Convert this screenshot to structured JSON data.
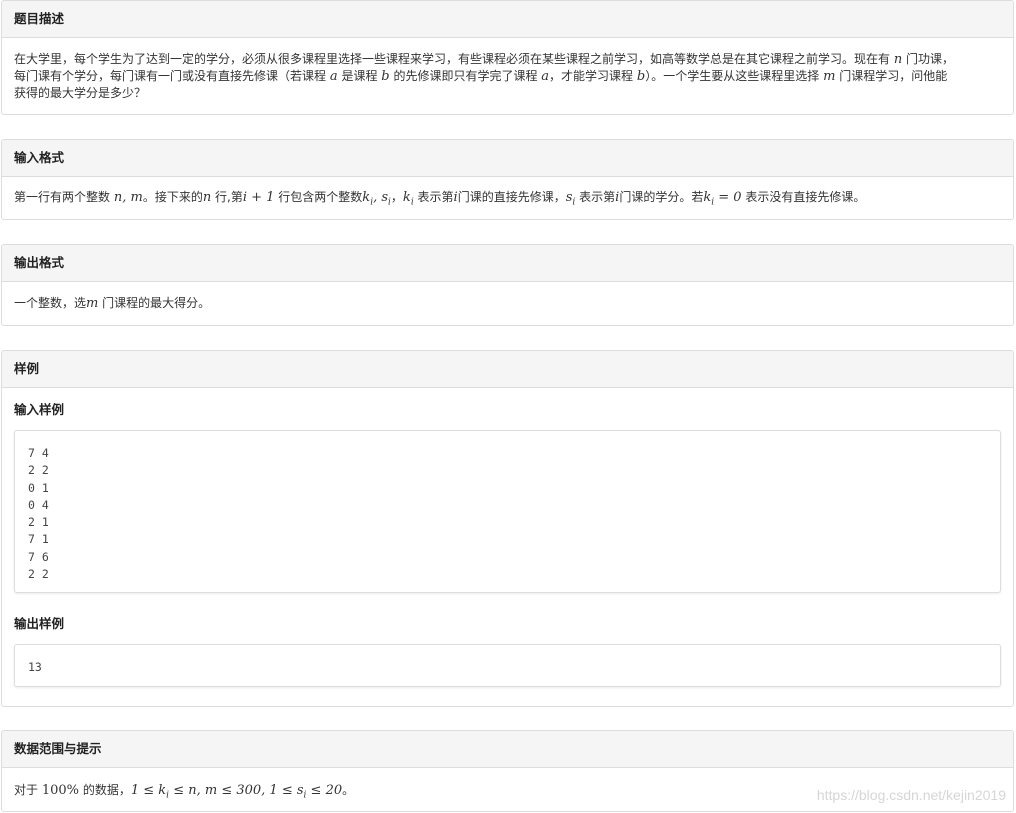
{
  "sections": {
    "description": {
      "title": "题目描述",
      "line1_a": "在大学里，每个学生为了达到一定的学分，必须从很多课程里选择一些课程来学习，有些课程必须在某些课程之前学习，如高等数学总是在其它课程之前学习。现在有",
      "line1_n": "n",
      "line1_b": "门功课，",
      "line2_a": "每门课有个学分，每门课有一门或没有直接先修课（若课程",
      "line2_a_var": "a",
      "line2_b": "是课程",
      "line2_b_var": "b",
      "line2_c": "的先修课即只有学完了课程",
      "line2_c_var": "a",
      "line2_d": "，才能学习课程",
      "line2_d_var": "b",
      "line2_e": "）。一个学生要从这些课程里选择",
      "line2_m": "m",
      "line2_f": "门课程学习，问他能",
      "line3": "获得的最大学分是多少？"
    },
    "input_format": {
      "title": "输入格式",
      "t1": "第一行有两个整数",
      "m1": "n, m",
      "t2": "。接下来的",
      "m2": "n",
      "t3": "行,第",
      "m3": "i + 1",
      "t4": "行包含两个整数",
      "m4": "k",
      "m4sub": "i",
      "m4b": ", s",
      "m4bsub": "i",
      "t5": "，",
      "m5": "k",
      "m5sub": "i",
      "t6": "表示第",
      "m6": "i",
      "t7": "门课的直接先修课，",
      "m7": "s",
      "m7sub": "i",
      "t8": "表示第",
      "m8": "i",
      "t9": "门课的学分。若",
      "m9": "k",
      "m9sub": "i",
      "m9b": " = 0",
      "t10": "表示没有直接先修课。"
    },
    "output_format": {
      "title": "输出格式",
      "t1": "一个整数，选",
      "m1": "m",
      "t2": "门课程的最大得分。"
    },
    "sample": {
      "title": "样例",
      "input_label": "输入样例",
      "input_text": "7 4\n2 2\n0 1\n0 4\n2 1\n7 1\n7 6\n2 2",
      "output_label": "输出样例",
      "output_text": "13"
    },
    "hint": {
      "title": "数据范围与提示",
      "t1": "对于",
      "m1": "100%",
      "t2": "的数据，",
      "m2a": "1 ≤ k",
      "m2asub": "i",
      "m2b": " ≤ n, m ≤ 300, 1 ≤ s",
      "m2bsub": "i",
      "m2c": " ≤ 20",
      "t3": "。"
    }
  },
  "watermark": "https://blog.csdn.net/kejin2019"
}
